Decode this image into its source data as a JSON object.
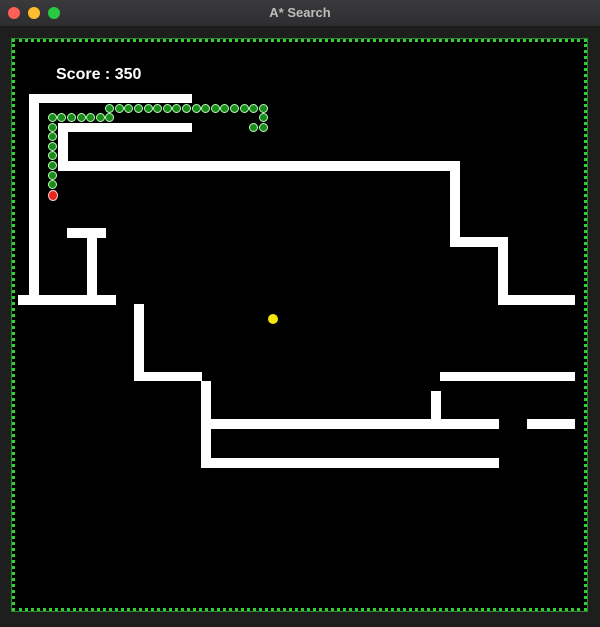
{
  "window": {
    "title": "A* Search"
  },
  "game": {
    "score_text": "Score : 350",
    "colors": {
      "background": "#000000",
      "wall": "#ffffff",
      "border": "#35d035",
      "snake_body": "#1a8a1a",
      "snake_head": "#e8261c",
      "food": "#f5e60c"
    },
    "icons": [
      "close-icon",
      "minimize-icon",
      "zoom-icon"
    ]
  }
}
